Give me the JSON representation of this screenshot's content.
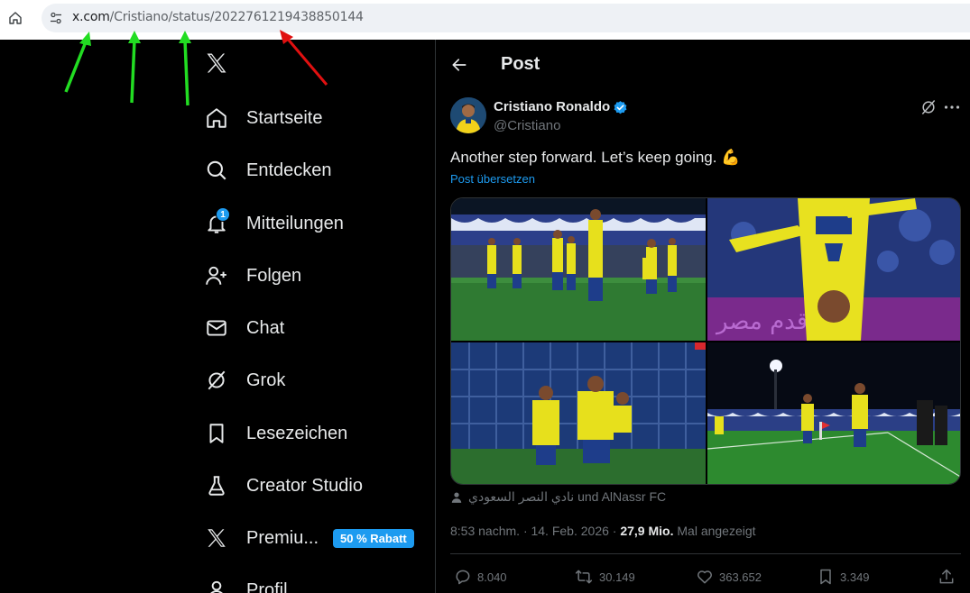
{
  "browser": {
    "url_host": "x.com",
    "url_path": "/Cristiano/status/2022761219438850144"
  },
  "colors": {
    "accent": "#1d9bf0",
    "annotation_green": "#22dd22",
    "annotation_red": "#e01010"
  },
  "nav": {
    "logo": "x-logo-icon",
    "items": [
      {
        "label": "Startseite",
        "icon": "home-icon"
      },
      {
        "label": "Entdecken",
        "icon": "search-icon"
      },
      {
        "label": "Mitteilungen",
        "icon": "bell-icon",
        "badge": "1"
      },
      {
        "label": "Folgen",
        "icon": "person-add-icon"
      },
      {
        "label": "Chat",
        "icon": "mail-icon"
      },
      {
        "label": "Grok",
        "icon": "grok-icon"
      },
      {
        "label": "Lesezeichen",
        "icon": "bookmark-icon"
      },
      {
        "label": "Creator Studio",
        "icon": "flask-icon"
      },
      {
        "label": "Premiu...",
        "icon": "x-premium-icon",
        "promo": "50 % Rabatt"
      },
      {
        "label": "Profil",
        "icon": "profile-icon"
      }
    ]
  },
  "main": {
    "title": "Post",
    "author": {
      "name": "Cristiano Ronaldo",
      "handle": "@Cristiano"
    },
    "text": "Another step forward. Let’s keep going. 💪",
    "translate": "Post übersetzen",
    "tagged": "نادي النصر السعودي und AlNassr FC",
    "meta": {
      "time": "8:53 nachm. · 14. Feb. 2026 · ",
      "views": "27,9 Mio.",
      "views_label": " Mal angezeigt"
    },
    "actions": {
      "replies": "8.040",
      "reposts": "30.149",
      "likes": "363.652",
      "bookmarks": "3.349"
    }
  }
}
